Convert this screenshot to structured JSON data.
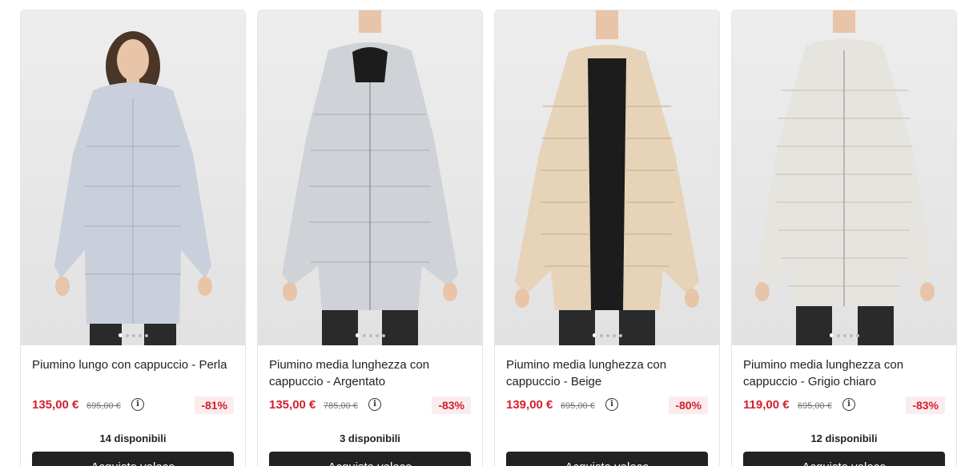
{
  "products": [
    {
      "title": "Piumino lungo con cappuccio - Perla",
      "price": "135,00 €",
      "old_price": "695,00 €",
      "discount": "-81%",
      "stock": "14 disponibili",
      "button": "Acquisto veloce",
      "coat_color": "#c9d0db"
    },
    {
      "title": "Piumino media lunghezza con cappuccio - Argentato",
      "price": "135,00 €",
      "old_price": "785,00 €",
      "discount": "-83%",
      "stock": "3 disponibili",
      "button": "Acquisto veloce",
      "coat_color": "#cfd3d8"
    },
    {
      "title": "Piumino media lunghezza con cappuccio - Beige",
      "price": "139,00 €",
      "old_price": "695,00 €",
      "discount": "-80%",
      "stock": "",
      "button": "Acquisto veloce",
      "coat_color": "#e6d3b8"
    },
    {
      "title": "Piumino media lunghezza con cappuccio - Grigio chiaro",
      "price": "119,00 €",
      "old_price": "695,00 €",
      "discount": "-83%",
      "stock": "12 disponibili",
      "button": "Acquisto veloce",
      "coat_color": "#e6e4df"
    }
  ],
  "colors": {
    "price_red": "#d4202c",
    "button_dark": "#222222",
    "discount_bg": "#fbeced"
  }
}
